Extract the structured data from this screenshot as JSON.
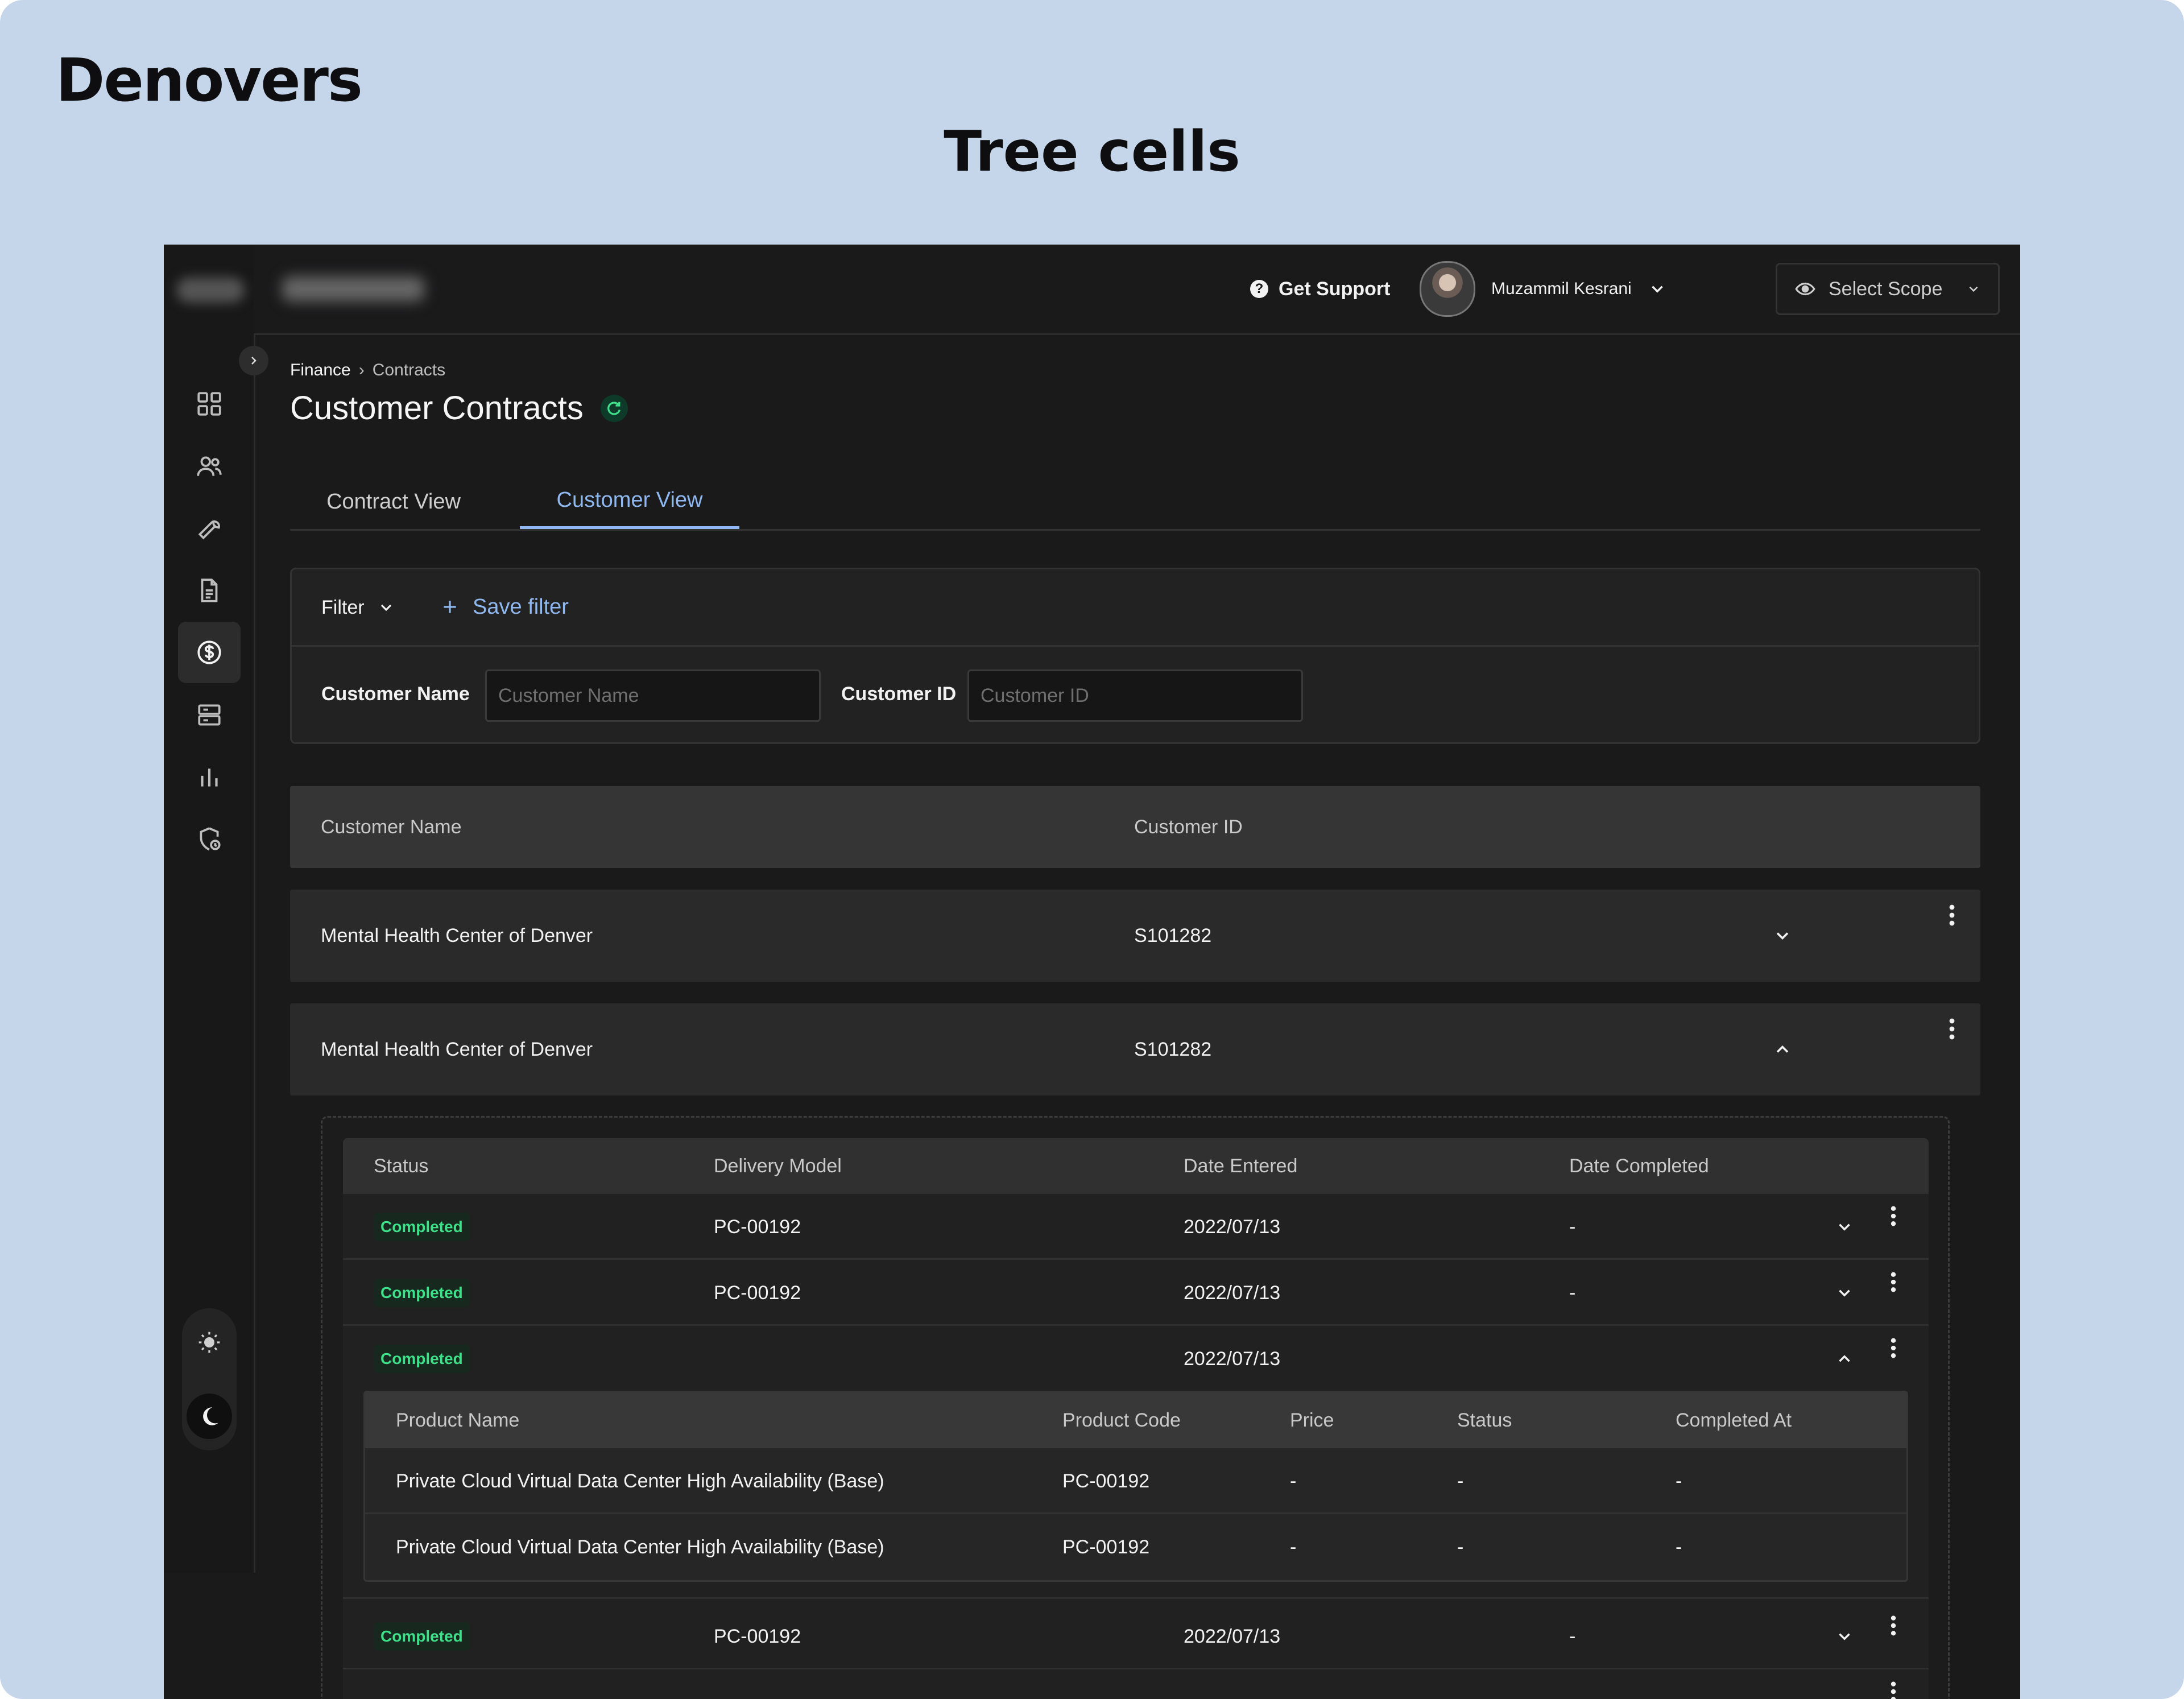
{
  "brand": "Denovers",
  "heading": "Tree cells",
  "colors": {
    "background": "#c5d6ea",
    "app_bg": "#1a1a1b",
    "accent": "#8fb8f0",
    "success": "#3ee08a"
  },
  "topbar": {
    "support_label": "Get Support",
    "user_name": "Muzammil Kesrani",
    "scope_label": "Select Scope"
  },
  "sidebar": {
    "items": [
      "grid-icon",
      "users-icon",
      "wrench-icon",
      "document-icon",
      "dollar-icon",
      "server-icon",
      "bar-chart-icon",
      "shield-icon"
    ],
    "active_index": 4
  },
  "breadcrumb": {
    "parent": "Finance",
    "separator": "›",
    "current": "Contracts"
  },
  "page_title": "Customer Contracts",
  "tabs": [
    {
      "label": "Contract View"
    },
    {
      "label": "Customer View",
      "active": true
    }
  ],
  "filter": {
    "label": "Filter",
    "save_label": "Save filter",
    "fields": [
      {
        "label": "Customer Name",
        "placeholder": "Customer Name"
      },
      {
        "label": "Customer ID",
        "placeholder": "Customer ID"
      }
    ]
  },
  "table": {
    "headers": [
      "Customer Name",
      "Customer ID"
    ],
    "rows": [
      {
        "name": "Mental Health Center of Denver",
        "id": "S101282",
        "expanded": false
      },
      {
        "name": "Mental Health Center of Denver",
        "id": "S101282",
        "expanded": true
      }
    ]
  },
  "contracts": {
    "headers": [
      "Status",
      "Delivery Model",
      "Date Entered",
      "Date Completed"
    ],
    "rows": [
      {
        "status": "Completed",
        "model": "PC-00192",
        "entered": "2022/07/13",
        "completed": "-"
      },
      {
        "status": "Completed",
        "model": "PC-00192",
        "entered": "2022/07/13",
        "completed": "-"
      },
      {
        "status": "Completed",
        "model": "",
        "entered": "2022/07/13",
        "completed": ""
      },
      {
        "status": "Completed",
        "model": "PC-00192",
        "entered": "2022/07/13",
        "completed": "-"
      }
    ]
  },
  "products": {
    "headers": [
      "Product Name",
      "Product Code",
      "Price",
      "Status",
      "Completed At"
    ],
    "rows": [
      {
        "name": "Private Cloud Virtual Data Center High Availability (Base)",
        "code": "PC-00192",
        "price": "-",
        "status": "-",
        "completed_at": "-"
      },
      {
        "name": "Private Cloud Virtual Data Center High Availability (Base)",
        "code": "PC-00192",
        "price": "-",
        "status": "-",
        "completed_at": "-"
      }
    ]
  }
}
